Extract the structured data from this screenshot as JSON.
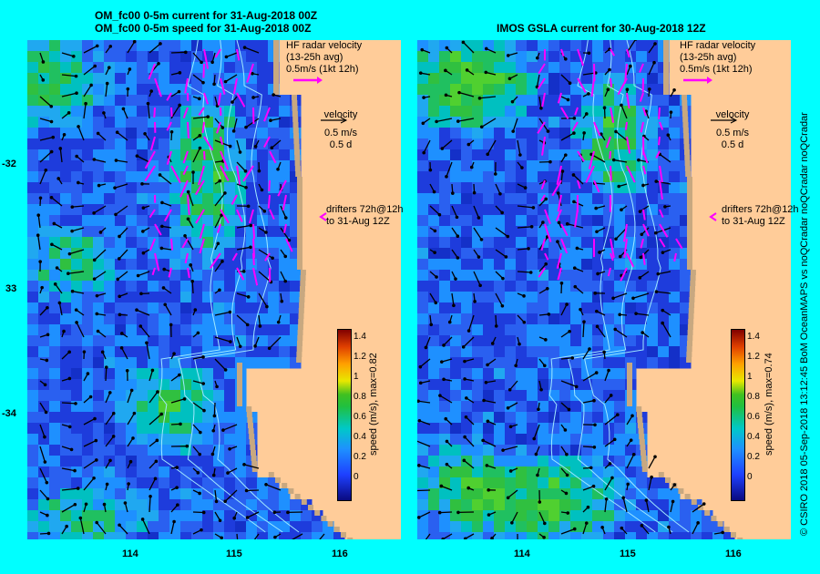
{
  "left_panel": {
    "title_line1": "OM_fc00 0-5m current for 31-Aug-2018 00Z",
    "title_line2": "OM_fc00 0-5m speed for 31-Aug-2018 00Z",
    "colorbar_label": "speed (m/s), max=0.82"
  },
  "right_panel": {
    "title_line1": "IMOS GSLA current for 30-Aug-2018 12Z",
    "colorbar_label": "speed (m/s), max=0.74"
  },
  "legend": {
    "hf_line1": "HF radar velocity",
    "hf_line2": "(13-25h avg)",
    "hf_line3": "0.5m/s (1kt 12h)",
    "vel_line1": "velocity",
    "vel_line2": "0.5 m/s",
    "vel_line3": "0.5 d",
    "drift_line1": "drifters 72h@12h",
    "drift_line2": "to 31-Aug 12Z"
  },
  "axes": {
    "x_ticks": [
      "114",
      "115",
      "116"
    ],
    "y_ticks": [
      "-32",
      "33",
      "-34"
    ]
  },
  "colorbar_ticks": [
    "1.4",
    "1.2",
    "1",
    "0.8",
    "0.6",
    "0.4",
    "0.2",
    "0"
  ],
  "credit": "© CSIRO 2018   05-Sep-2018 13:12:45 BoM OceanMAPS vs noQCradar noQCradar noQCradar",
  "colors": {
    "land": "#ffcc99",
    "coast_shelf": "#c8a880",
    "border": "#00ffff",
    "hf_arrow": "#ff00ff",
    "field_low": "#1e3cdc",
    "field_mid": "#1e90ff",
    "field_high": "#20c040"
  }
}
